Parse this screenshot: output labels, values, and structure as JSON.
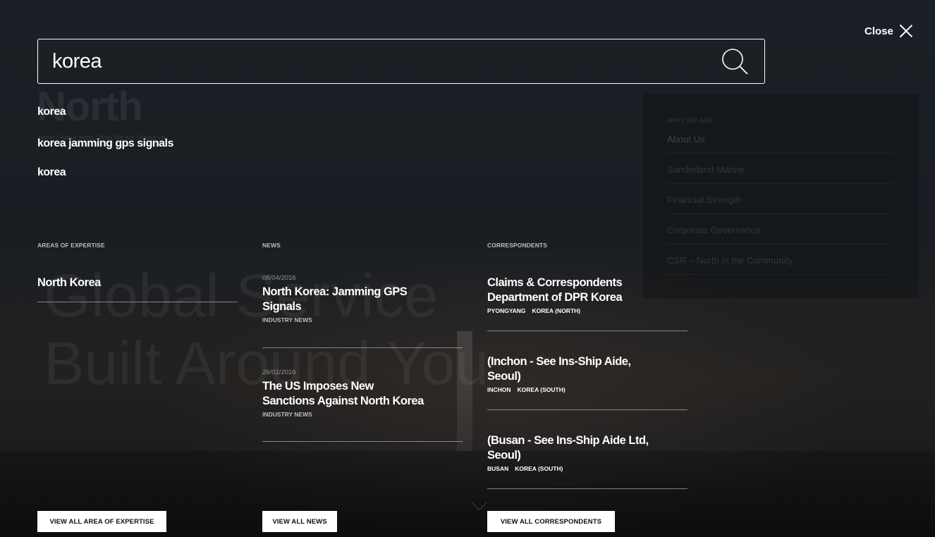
{
  "background": {
    "logo": "North",
    "breadcrumb": "Home / About North / Who We Are / About Us",
    "slogan_line1": "Global Service",
    "slogan_line2": "Built Around You",
    "panel": {
      "heading": "WHO WE ARE",
      "items": [
        "About Us",
        "Sunderland Marine",
        "Financial Strength",
        "Corporate Governance",
        "CSR – North in the Community"
      ]
    }
  },
  "close": {
    "label": "Close"
  },
  "search": {
    "value": "korea"
  },
  "suggestions": [
    "korea",
    "korea jamming gps signals",
    "korea"
  ],
  "expertise": {
    "heading": "AREAS OF EXPERTISE",
    "items": [
      {
        "title": "North Korea"
      }
    ],
    "button": "VIEW ALL AREA OF EXPERTISE"
  },
  "news": {
    "heading": "NEWS",
    "items": [
      {
        "date": "08/04/2016",
        "title_line1": "North Korea: Jamming GPS",
        "title_line2": "Signals",
        "category": "INDUSTRY NEWS"
      },
      {
        "date": "26/02/2016",
        "title_line1": "The US Imposes New",
        "title_line2": "Sanctions Against North Korea",
        "category": "INDUSTRY NEWS"
      }
    ],
    "button": "VIEW ALL NEWS"
  },
  "correspondents": {
    "heading": "CORRESPONDENTS",
    "items": [
      {
        "title_line1": "Claims & Correspondents",
        "title_line2": "Department of DPR Korea",
        "city": "PYONGYANG",
        "country": "KOREA (NORTH)"
      },
      {
        "title_line1": "(Inchon - See Ins-Ship Aide,",
        "title_line2": "Seoul)",
        "city": "INCHON",
        "country": "KOREA (SOUTH)"
      },
      {
        "title_line1": "(Busan - See Ins-Ship Aide Ltd,",
        "title_line2": "Seoul)",
        "city": "BUSAN",
        "country": "KOREA (SOUTH)"
      }
    ],
    "button": "VIEW ALL CORRESPONDENTS"
  }
}
